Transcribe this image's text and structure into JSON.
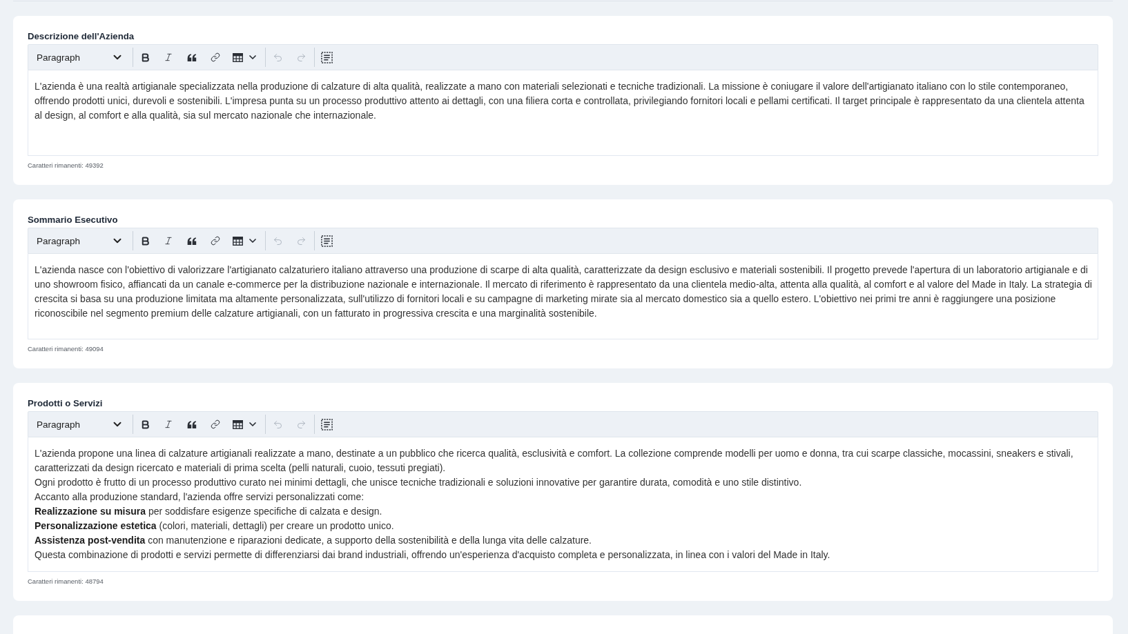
{
  "sections": [
    {
      "label": "Descrizione dell'Azienda",
      "toolbar": {
        "block_format": "Paragraph",
        "tool_groups": [
          [
            {
              "kind": "bold",
              "disabled": false
            },
            {
              "kind": "italic",
              "disabled": false
            },
            {
              "kind": "quote",
              "disabled": false
            },
            {
              "kind": "link",
              "disabled": false
            },
            {
              "kind": "table",
              "disabled": false
            }
          ],
          [
            {
              "kind": "undo",
              "disabled": true
            },
            {
              "kind": "redo",
              "disabled": true
            }
          ],
          [
            {
              "kind": "select_all",
              "disabled": false
            }
          ]
        ]
      },
      "paragraphs": [
        "L'azienda è una realtà artigianale specializzata nella produzione di calzature di alta qualità, realizzate a mano con materiali selezionati e tecniche tradizionali. La missione è coniugare il valore dell'artigianato italiano con lo stile contemporaneo, offrendo prodotti unici, durevoli e sostenibili. L'impresa punta su un processo produttivo attento ai dettagli, con una filiera corta e controllata, privilegiando fornitori locali e pellami certificati. Il target principale è rappresentato da una clientela attenta al design, al comfort e alla qualità, sia sul mercato nazionale che internazionale."
      ],
      "remaining": "Caratteri rimanenti: 49392"
    },
    {
      "label": "Sommario Esecutivo",
      "toolbar": {
        "block_format": "Paragraph",
        "tool_groups": [
          [
            {
              "kind": "bold",
              "disabled": false
            },
            {
              "kind": "italic",
              "disabled": false
            },
            {
              "kind": "quote",
              "disabled": false
            },
            {
              "kind": "link",
              "disabled": false
            },
            {
              "kind": "table",
              "disabled": false
            }
          ],
          [
            {
              "kind": "undo",
              "disabled": true
            },
            {
              "kind": "redo",
              "disabled": true
            }
          ],
          [
            {
              "kind": "select_all",
              "disabled": false
            }
          ]
        ]
      },
      "paragraphs": [
        "L'azienda nasce con l'obiettivo di valorizzare l'artigianato calzaturiero italiano attraverso una produzione di scarpe di alta qualità, caratterizzate da design esclusivo e materiali sostenibili. Il progetto prevede l'apertura di un laboratorio artigianale e di uno showroom fisico, affiancati da un canale e-commerce per la distribuzione nazionale e internazionale. Il mercato di riferimento è rappresentato da una clientela medio-alta, attenta alla qualità, al comfort e al valore del Made in Italy. La strategia di crescita si basa su una produzione limitata ma altamente personalizzata, sull'utilizzo di fornitori locali e su campagne di marketing mirate sia al mercato domestico sia a quello estero. L'obiettivo nei primi tre anni è raggiungere una posizione riconoscibile nel segmento premium delle calzature artigianali, con un fatturato in progressiva crescita e una marginalità sostenibile."
      ],
      "remaining": "Caratteri rimanenti: 49094"
    },
    {
      "label": "Prodotti o Servizi",
      "toolbar": {
        "block_format": "Paragraph",
        "tool_groups": [
          [
            {
              "kind": "bold",
              "disabled": false
            },
            {
              "kind": "italic",
              "disabled": false
            },
            {
              "kind": "quote",
              "disabled": false
            },
            {
              "kind": "link",
              "disabled": false
            },
            {
              "kind": "table",
              "disabled": false
            }
          ],
          [
            {
              "kind": "undo",
              "disabled": true
            },
            {
              "kind": "redo",
              "disabled": true
            }
          ],
          [
            {
              "kind": "select_all",
              "disabled": false
            }
          ]
        ]
      },
      "paragraphs": [
        "L'azienda propone una linea di calzature artigianali realizzate a mano, destinate a un pubblico che ricerca qualità, esclusività e comfort. La collezione comprende modelli per uomo e donna, tra cui scarpe classiche, mocassini, sneakers e stivali, caratterizzati da design ricercato e materiali di prima scelta (pelli naturali, cuoio, tessuti pregiati).",
        "Ogni prodotto è frutto di un processo produttivo curato nei minimi dettagli, che unisce tecniche tradizionali e soluzioni innovative per garantire durata, comodità e uno stile distintivo.",
        "Accanto alla produzione standard, l'azienda offre servizi personalizzati come:",
        "**Realizzazione su misura** per soddisfare esigenze specifiche di calzata e design.",
        "**Personalizzazione estetica** (colori, materiali, dettagli) per creare un prodotto unico.",
        "**Assistenza post-vendita** con manutenzione e riparazioni dedicate, a supporto della sostenibilità e della lunga vita delle calzature.",
        "Questa combinazione di prodotti e servizi permette di differenziarsi dai brand industriali, offrendo un'esperienza d'acquisto completa e personalizzata, in linea con i valori del Made in Italy."
      ],
      "remaining": "Caratteri rimanenti: 48794"
    }
  ]
}
